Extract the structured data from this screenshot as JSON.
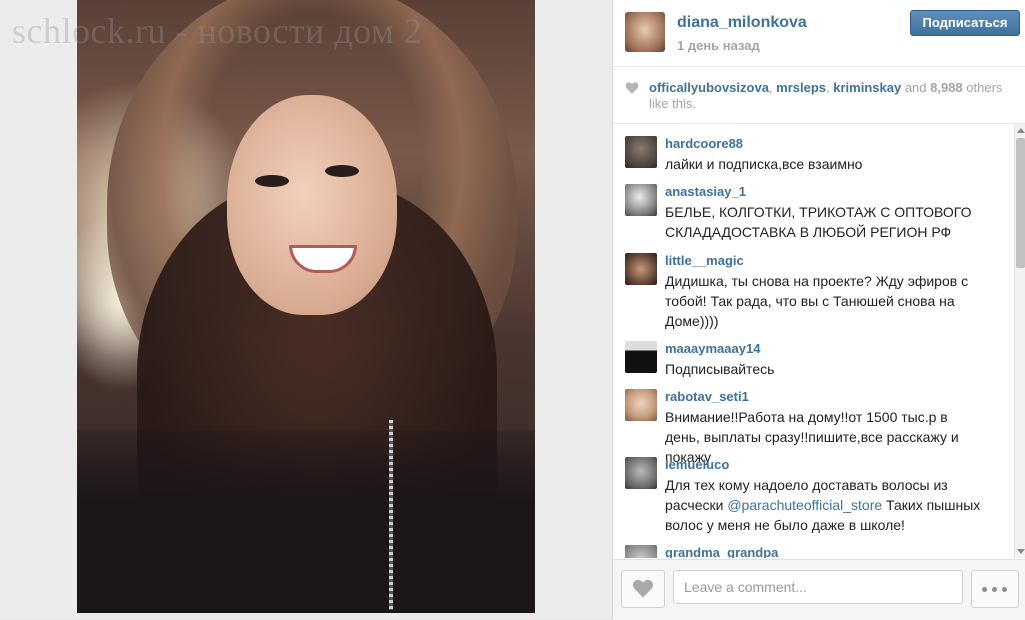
{
  "watermark": "schlock.ru - новости дом 2",
  "post": {
    "username": "diana_milonkova",
    "timestamp": "1 день назад",
    "follow_label": "Подписаться"
  },
  "likes": {
    "users": [
      "officallyubovsizova",
      "mrsleps",
      "kriminskay"
    ],
    "sep1": ", ",
    "sep2": ", ",
    "and": " and ",
    "count": "8,988",
    "suffix": " others like this."
  },
  "comments": [
    {
      "user": "hardcoore88",
      "text": "лайки и подписка,все взаимно"
    },
    {
      "user": "anastasiay_1",
      "text": "БЕЛЬЕ, КОЛГОТКИ, ТРИКОТАЖ С ОПТОВОГО СКЛАДАДОСТАВКА В ЛЮБОЙ РЕГИОН РФ"
    },
    {
      "user": "little__magic",
      "text": "Дидишка, ты снова на проекте? Жду эфиров с тобой! Так рада, что вы с Танюшей снова на Доме))))"
    },
    {
      "user": "maaaymaaay14",
      "text": "Подписывайтесь"
    },
    {
      "user": "rabotav_seti1",
      "text": "Внимание!!Работа на дому!!от 1500 тыс.р в день, выплаты сразу!!пишите,все расскажу и покажу"
    },
    {
      "user": "lemueluco",
      "text_before": "Для тех кому надоело доставать волосы из расчески ",
      "mention": "@parachuteofficial_store",
      "text_after": " Таких пышных волос у меня не было даже в школе!"
    },
    {
      "user": "grandma_grandpa",
      "text": ""
    }
  ],
  "footer": {
    "comment_placeholder": "Leave a comment..."
  },
  "colors": {
    "link": "#3f729b",
    "follow_button": "#3f729b",
    "muted": "#a5a5a5"
  },
  "icons": [
    "heart-icon",
    "more-dots-icon"
  ]
}
